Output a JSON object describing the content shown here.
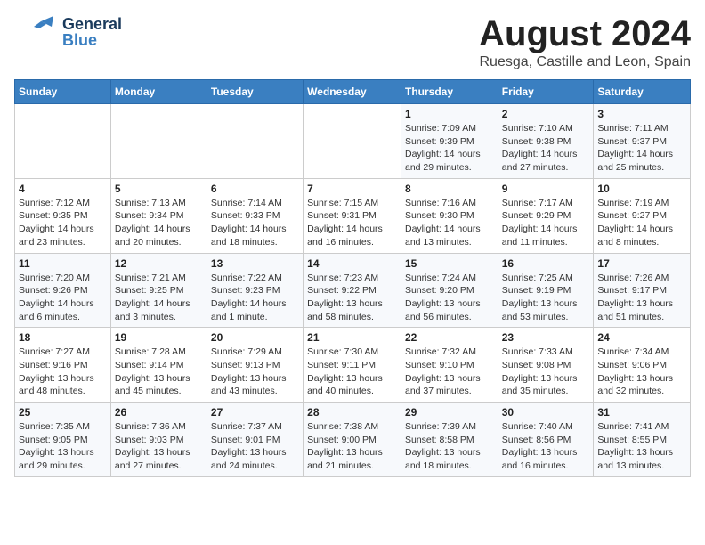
{
  "header": {
    "logo_general": "General",
    "logo_blue": "Blue",
    "title": "August 2024",
    "subtitle": "Ruesga, Castille and Leon, Spain"
  },
  "days_of_week": [
    "Sunday",
    "Monday",
    "Tuesday",
    "Wednesday",
    "Thursday",
    "Friday",
    "Saturday"
  ],
  "weeks": [
    [
      {
        "num": "",
        "info": ""
      },
      {
        "num": "",
        "info": ""
      },
      {
        "num": "",
        "info": ""
      },
      {
        "num": "",
        "info": ""
      },
      {
        "num": "1",
        "info": "Sunrise: 7:09 AM\nSunset: 9:39 PM\nDaylight: 14 hours and 29 minutes."
      },
      {
        "num": "2",
        "info": "Sunrise: 7:10 AM\nSunset: 9:38 PM\nDaylight: 14 hours and 27 minutes."
      },
      {
        "num": "3",
        "info": "Sunrise: 7:11 AM\nSunset: 9:37 PM\nDaylight: 14 hours and 25 minutes."
      }
    ],
    [
      {
        "num": "4",
        "info": "Sunrise: 7:12 AM\nSunset: 9:35 PM\nDaylight: 14 hours and 23 minutes."
      },
      {
        "num": "5",
        "info": "Sunrise: 7:13 AM\nSunset: 9:34 PM\nDaylight: 14 hours and 20 minutes."
      },
      {
        "num": "6",
        "info": "Sunrise: 7:14 AM\nSunset: 9:33 PM\nDaylight: 14 hours and 18 minutes."
      },
      {
        "num": "7",
        "info": "Sunrise: 7:15 AM\nSunset: 9:31 PM\nDaylight: 14 hours and 16 minutes."
      },
      {
        "num": "8",
        "info": "Sunrise: 7:16 AM\nSunset: 9:30 PM\nDaylight: 14 hours and 13 minutes."
      },
      {
        "num": "9",
        "info": "Sunrise: 7:17 AM\nSunset: 9:29 PM\nDaylight: 14 hours and 11 minutes."
      },
      {
        "num": "10",
        "info": "Sunrise: 7:19 AM\nSunset: 9:27 PM\nDaylight: 14 hours and 8 minutes."
      }
    ],
    [
      {
        "num": "11",
        "info": "Sunrise: 7:20 AM\nSunset: 9:26 PM\nDaylight: 14 hours and 6 minutes."
      },
      {
        "num": "12",
        "info": "Sunrise: 7:21 AM\nSunset: 9:25 PM\nDaylight: 14 hours and 3 minutes."
      },
      {
        "num": "13",
        "info": "Sunrise: 7:22 AM\nSunset: 9:23 PM\nDaylight: 14 hours and 1 minute."
      },
      {
        "num": "14",
        "info": "Sunrise: 7:23 AM\nSunset: 9:22 PM\nDaylight: 13 hours and 58 minutes."
      },
      {
        "num": "15",
        "info": "Sunrise: 7:24 AM\nSunset: 9:20 PM\nDaylight: 13 hours and 56 minutes."
      },
      {
        "num": "16",
        "info": "Sunrise: 7:25 AM\nSunset: 9:19 PM\nDaylight: 13 hours and 53 minutes."
      },
      {
        "num": "17",
        "info": "Sunrise: 7:26 AM\nSunset: 9:17 PM\nDaylight: 13 hours and 51 minutes."
      }
    ],
    [
      {
        "num": "18",
        "info": "Sunrise: 7:27 AM\nSunset: 9:16 PM\nDaylight: 13 hours and 48 minutes."
      },
      {
        "num": "19",
        "info": "Sunrise: 7:28 AM\nSunset: 9:14 PM\nDaylight: 13 hours and 45 minutes."
      },
      {
        "num": "20",
        "info": "Sunrise: 7:29 AM\nSunset: 9:13 PM\nDaylight: 13 hours and 43 minutes."
      },
      {
        "num": "21",
        "info": "Sunrise: 7:30 AM\nSunset: 9:11 PM\nDaylight: 13 hours and 40 minutes."
      },
      {
        "num": "22",
        "info": "Sunrise: 7:32 AM\nSunset: 9:10 PM\nDaylight: 13 hours and 37 minutes."
      },
      {
        "num": "23",
        "info": "Sunrise: 7:33 AM\nSunset: 9:08 PM\nDaylight: 13 hours and 35 minutes."
      },
      {
        "num": "24",
        "info": "Sunrise: 7:34 AM\nSunset: 9:06 PM\nDaylight: 13 hours and 32 minutes."
      }
    ],
    [
      {
        "num": "25",
        "info": "Sunrise: 7:35 AM\nSunset: 9:05 PM\nDaylight: 13 hours and 29 minutes."
      },
      {
        "num": "26",
        "info": "Sunrise: 7:36 AM\nSunset: 9:03 PM\nDaylight: 13 hours and 27 minutes."
      },
      {
        "num": "27",
        "info": "Sunrise: 7:37 AM\nSunset: 9:01 PM\nDaylight: 13 hours and 24 minutes."
      },
      {
        "num": "28",
        "info": "Sunrise: 7:38 AM\nSunset: 9:00 PM\nDaylight: 13 hours and 21 minutes."
      },
      {
        "num": "29",
        "info": "Sunrise: 7:39 AM\nSunset: 8:58 PM\nDaylight: 13 hours and 18 minutes."
      },
      {
        "num": "30",
        "info": "Sunrise: 7:40 AM\nSunset: 8:56 PM\nDaylight: 13 hours and 16 minutes."
      },
      {
        "num": "31",
        "info": "Sunrise: 7:41 AM\nSunset: 8:55 PM\nDaylight: 13 hours and 13 minutes."
      }
    ]
  ]
}
